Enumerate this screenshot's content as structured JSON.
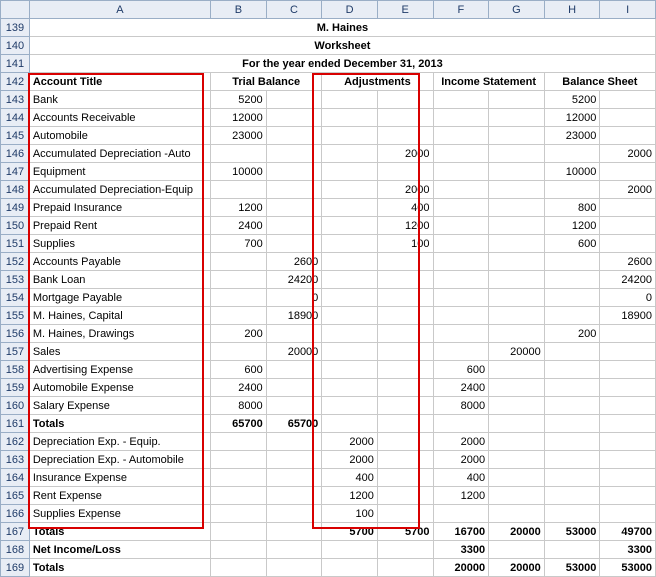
{
  "cols": [
    "A",
    "B",
    "C",
    "D",
    "E",
    "F",
    "G",
    "H",
    "I"
  ],
  "title1": "M. Haines",
  "title2": "Worksheet",
  "title3": "For the year ended December 31, 2013",
  "headers": {
    "acct": "Account Title",
    "tb": "Trial Balance",
    "adj": "Adjustments",
    "is": "Income Statement",
    "bs": "Balance Sheet"
  },
  "rows": [
    {
      "n": 143,
      "a": "Bank",
      "b": "5200",
      "h": "5200"
    },
    {
      "n": 144,
      "a": "Accounts Receivable",
      "b": "12000",
      "h": "12000"
    },
    {
      "n": 145,
      "a": "Automobile",
      "b": "23000",
      "h": "23000"
    },
    {
      "n": 146,
      "a": "Accumulated Depreciation -Auto",
      "e": "2000",
      "i": "2000"
    },
    {
      "n": 147,
      "a": "Equipment",
      "b": "10000",
      "h": "10000"
    },
    {
      "n": 148,
      "a": "Accumulated Depreciation-Equip",
      "e": "2000",
      "i": "2000"
    },
    {
      "n": 149,
      "a": "Prepaid Insurance",
      "b": "1200",
      "e": "400",
      "h": "800"
    },
    {
      "n": 150,
      "a": "Prepaid Rent",
      "b": "2400",
      "e": "1200",
      "h": "1200"
    },
    {
      "n": 151,
      "a": "Supplies",
      "b": "700",
      "e": "100",
      "h": "600"
    },
    {
      "n": 152,
      "a": "Accounts Payable",
      "c": "2600",
      "i": "2600"
    },
    {
      "n": 153,
      "a": "Bank Loan",
      "c": "24200",
      "i": "24200"
    },
    {
      "n": 154,
      "a": "Mortgage Payable",
      "c": "0",
      "i": "0"
    },
    {
      "n": 155,
      "a": "M. Haines, Capital",
      "c": "18900",
      "i": "18900"
    },
    {
      "n": 156,
      "a": "M. Haines, Drawings",
      "b": "200",
      "h": "200"
    },
    {
      "n": 157,
      "a": "Sales",
      "c": "20000",
      "g": "20000"
    },
    {
      "n": 158,
      "a": "Advertising Expense",
      "b": "600",
      "f": "600"
    },
    {
      "n": 159,
      "a": "Automobile Expense",
      "b": "2400",
      "f": "2400"
    },
    {
      "n": 160,
      "a": "Salary Expense",
      "b": "8000",
      "f": "8000"
    },
    {
      "n": 161,
      "a": "Totals",
      "b": "65700",
      "c": "65700",
      "bold": true
    },
    {
      "n": 162,
      "a": "Depreciation Exp. - Equip.",
      "d": "2000",
      "f": "2000"
    },
    {
      "n": 163,
      "a": "Depreciation Exp. - Automobile",
      "d": "2000",
      "f": "2000"
    },
    {
      "n": 164,
      "a": "Insurance Expense",
      "d": "400",
      "f": "400"
    },
    {
      "n": 165,
      "a": "Rent Expense",
      "d": "1200",
      "f": "1200"
    },
    {
      "n": 166,
      "a": "Supplies Expense",
      "d": "100"
    },
    {
      "n": 167,
      "a": "Totals",
      "d": "5700",
      "e": "5700",
      "f": "16700",
      "g": "20000",
      "h": "53000",
      "i": "49700",
      "bold": true,
      "noRedBottom": true
    },
    {
      "n": 168,
      "a": "Net Income/Loss",
      "f": "3300",
      "i": "3300",
      "bold": true
    },
    {
      "n": 169,
      "a": "Totals",
      "f": "20000",
      "g": "20000",
      "h": "53000",
      "i": "53000",
      "bold": true
    }
  ],
  "chart_data": {
    "type": "table",
    "title": "M. Haines Worksheet — For the year ended December 31, 2013",
    "columns": [
      "Account Title",
      "Trial Balance Dr",
      "Trial Balance Cr",
      "Adjustments Dr",
      "Adjustments Cr",
      "Income Statement Dr",
      "Income Statement Cr",
      "Balance Sheet Dr",
      "Balance Sheet Cr"
    ],
    "data": [
      [
        "Bank",
        5200,
        null,
        null,
        null,
        null,
        null,
        5200,
        null
      ],
      [
        "Accounts Receivable",
        12000,
        null,
        null,
        null,
        null,
        null,
        12000,
        null
      ],
      [
        "Automobile",
        23000,
        null,
        null,
        null,
        null,
        null,
        23000,
        null
      ],
      [
        "Accumulated Depreciation -Auto",
        null,
        null,
        null,
        2000,
        null,
        null,
        null,
        2000
      ],
      [
        "Equipment",
        10000,
        null,
        null,
        null,
        null,
        null,
        10000,
        null
      ],
      [
        "Accumulated Depreciation-Equip",
        null,
        null,
        null,
        2000,
        null,
        null,
        null,
        2000
      ],
      [
        "Prepaid Insurance",
        1200,
        null,
        null,
        400,
        null,
        null,
        800,
        null
      ],
      [
        "Prepaid Rent",
        2400,
        null,
        null,
        1200,
        null,
        null,
        1200,
        null
      ],
      [
        "Supplies",
        700,
        null,
        null,
        100,
        null,
        null,
        600,
        null
      ],
      [
        "Accounts Payable",
        null,
        2600,
        null,
        null,
        null,
        null,
        null,
        2600
      ],
      [
        "Bank Loan",
        null,
        24200,
        null,
        null,
        null,
        null,
        null,
        24200
      ],
      [
        "Mortgage Payable",
        null,
        0,
        null,
        null,
        null,
        null,
        null,
        0
      ],
      [
        "M. Haines, Capital",
        null,
        18900,
        null,
        null,
        null,
        null,
        null,
        18900
      ],
      [
        "M. Haines, Drawings",
        200,
        null,
        null,
        null,
        null,
        null,
        200,
        null
      ],
      [
        "Sales",
        null,
        20000,
        null,
        null,
        null,
        20000,
        null,
        null
      ],
      [
        "Advertising Expense",
        600,
        null,
        null,
        null,
        600,
        null,
        null,
        null
      ],
      [
        "Automobile Expense",
        2400,
        null,
        null,
        null,
        2400,
        null,
        null,
        null
      ],
      [
        "Salary Expense",
        8000,
        null,
        null,
        null,
        8000,
        null,
        null,
        null
      ],
      [
        "Totals",
        65700,
        65700,
        null,
        null,
        null,
        null,
        null,
        null
      ],
      [
        "Depreciation Exp. - Equip.",
        null,
        null,
        2000,
        null,
        2000,
        null,
        null,
        null
      ],
      [
        "Depreciation Exp. - Automobile",
        null,
        null,
        2000,
        null,
        2000,
        null,
        null,
        null
      ],
      [
        "Insurance Expense",
        null,
        null,
        400,
        null,
        400,
        null,
        null,
        null
      ],
      [
        "Rent Expense",
        null,
        null,
        1200,
        null,
        1200,
        null,
        null,
        null
      ],
      [
        "Supplies Expense",
        null,
        null,
        100,
        null,
        null,
        null,
        null,
        null
      ],
      [
        "Totals",
        null,
        null,
        5700,
        5700,
        16700,
        20000,
        53000,
        49700
      ],
      [
        "Net Income/Loss",
        null,
        null,
        null,
        null,
        3300,
        null,
        null,
        3300
      ],
      [
        "Totals",
        null,
        null,
        null,
        null,
        20000,
        20000,
        53000,
        53000
      ]
    ]
  }
}
